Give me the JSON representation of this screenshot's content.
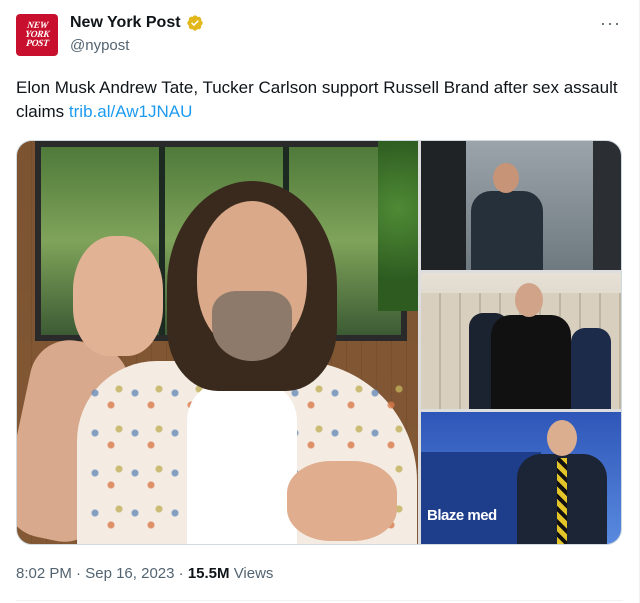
{
  "author": {
    "display_name": "New York Post",
    "handle": "@nypost",
    "avatar_lines": [
      "NEW",
      "YORK",
      "POST"
    ],
    "verified": true,
    "verified_color": "#e2b719"
  },
  "menu_icon": "more-horizontal-icon",
  "tweet": {
    "text": "Elon Musk Andrew Tate, Tucker Carlson support Russell Brand after sex assault claims",
    "link": "trib.al/Aw1JNAU"
  },
  "media": {
    "overlay_text": "Blaze med"
  },
  "meta": {
    "time": "8:02 PM",
    "date": "Sep 16, 2023",
    "views_count": "15.5M",
    "views_label": "Views"
  },
  "colors": {
    "accent": "#1d9bf0",
    "text": "#0f1419",
    "secondary": "#536471",
    "brand_red": "#c8102e"
  }
}
